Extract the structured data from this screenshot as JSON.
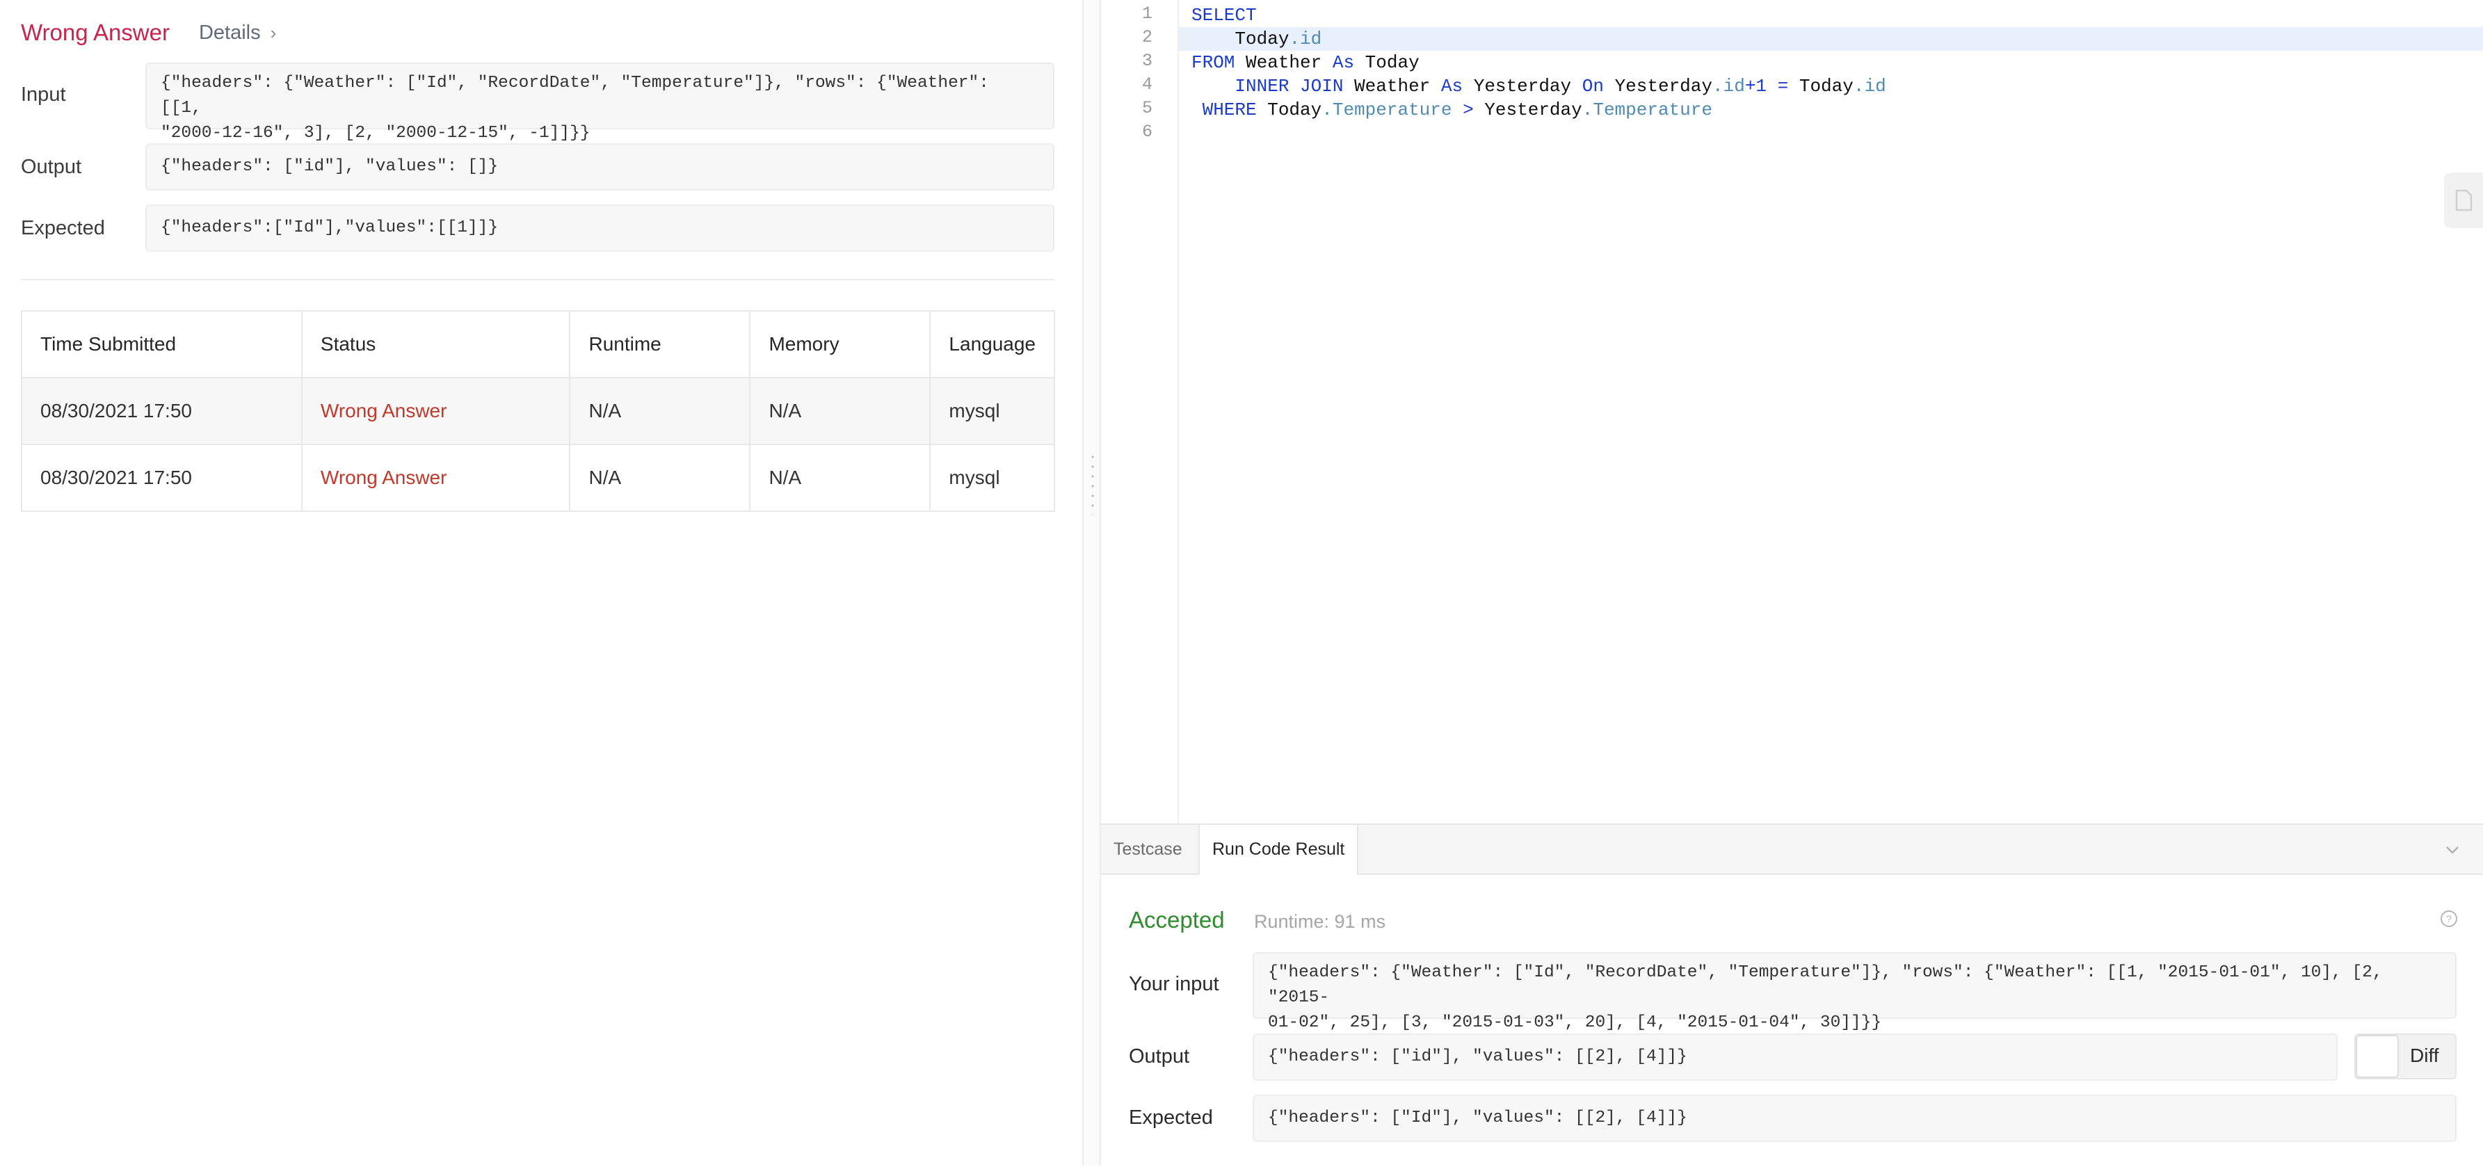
{
  "result": {
    "status_title": "Wrong Answer",
    "details_label": "Details",
    "input_label": "Input",
    "input_lines": [
      "{\"headers\": {\"Weather\": [\"Id\", \"RecordDate\", \"Temperature\"]}, \"rows\": {\"Weather\": [[1,",
      "\"2000-12-16\", 3], [2, \"2000-12-15\", -1]]}}"
    ],
    "output_label": "Output",
    "output_value": "{\"headers\": [\"id\"], \"values\": []}",
    "expected_label": "Expected",
    "expected_value": "{\"headers\":[\"Id\"],\"values\":[[1]]}"
  },
  "submissions": {
    "columns": [
      "Time Submitted",
      "Status",
      "Runtime",
      "Memory",
      "Language"
    ],
    "rows": [
      [
        "08/30/2021 17:50",
        "Wrong Answer",
        "N/A",
        "N/A",
        "mysql"
      ],
      [
        "08/30/2021 17:50",
        "Wrong Answer",
        "N/A",
        "N/A",
        "mysql"
      ]
    ]
  },
  "editor": {
    "line_numbers": [
      "1",
      "2",
      "3",
      "4",
      "5",
      "6"
    ],
    "active_line": 2
  },
  "console": {
    "tabs": [
      "Testcase",
      "Run Code Result"
    ],
    "active_tab": 1,
    "status": "Accepted",
    "runtime": "Runtime: 91 ms",
    "input_label": "Your input",
    "input_lines": [
      "{\"headers\": {\"Weather\": [\"Id\", \"RecordDate\", \"Temperature\"]}, \"rows\": {\"Weather\": [[1, \"2015-01-01\", 10], [2, \"2015-",
      "01-02\", 25], [3, \"2015-01-03\", 20], [4, \"2015-01-04\", 30]]}}"
    ],
    "output_label": "Output",
    "output_value": "{\"headers\": [\"id\"], \"values\": [[2], [4]]}",
    "expected_label": "Expected",
    "expected_value": "{\"headers\": [\"Id\"], \"values\": [[2], [4]]}",
    "diff_label": "Diff"
  },
  "colors": {
    "wrong": "#c7254e",
    "accepted": "#2e8b2e",
    "keyword": "#1c3cc7",
    "field": "#4f8bb0"
  }
}
